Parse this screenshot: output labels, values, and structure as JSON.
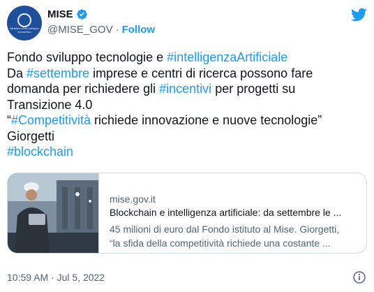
{
  "account": {
    "name": "MISE",
    "handle": "@MISE_GOV",
    "separator": "·",
    "follow_label": "Follow",
    "avatar_text": "Ministero dello sviluppo economico"
  },
  "tweet": {
    "text_lines": [
      [
        {
          "t": "Fondo sviluppo tecnologie e "
        },
        {
          "t": "#intelligenzaArtificiale",
          "tag": true
        }
      ],
      [
        {
          "t": "Da "
        },
        {
          "t": "#settembre",
          "tag": true
        },
        {
          "t": " imprese e centri di ricerca possono fare"
        }
      ],
      [
        {
          "t": "domanda per richiedere gli "
        },
        {
          "t": "#incentivi",
          "tag": true
        },
        {
          "t": " per progetti su"
        }
      ],
      [
        {
          "t": "Transizione 4.0"
        }
      ],
      [
        {
          "t": "“"
        },
        {
          "t": "#Competitività",
          "tag": true
        },
        {
          "t": " richiede innovazione e nuove tecnologie”"
        }
      ],
      [
        {
          "t": "Giorgetti"
        }
      ],
      [
        {
          "t": "#blockchain",
          "tag": true
        }
      ]
    ],
    "timestamp": "10:59 AM · Jul 5, 2022"
  },
  "card": {
    "domain": "mise.gov.it",
    "title": "Blockchain e intelligenza artificiale: da settembre le ...",
    "description_lines": [
      "45 milioni di euro dal Fondo istituto al Mise. Giorgetti,",
      "“la sfida della competitività richiede una costante ..."
    ]
  },
  "icons": {
    "verified": "verified-badge-icon",
    "brand": "twitter-bird-icon",
    "info": "info-icon"
  },
  "colors": {
    "accent": "#1d9bf0",
    "text": "#0f1419",
    "secondary": "#536471",
    "border": "#cfd9de",
    "avatar_bg": "#1f4e9a"
  }
}
